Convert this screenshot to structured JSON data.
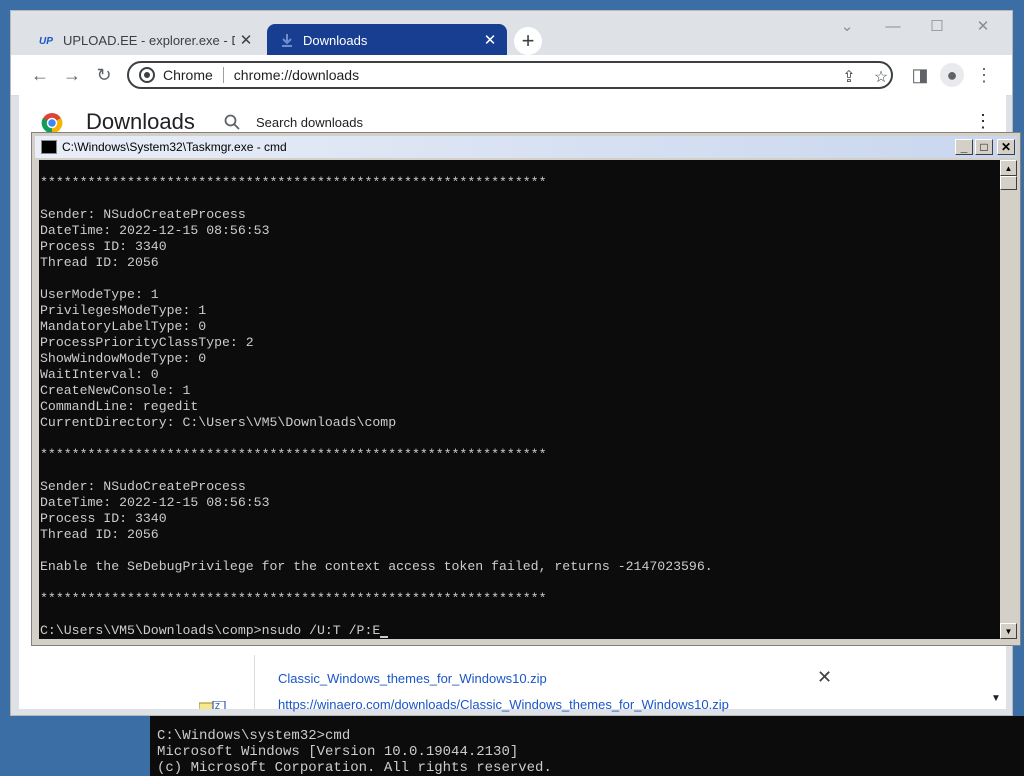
{
  "background_cmd": {
    "lines": [
      "C:\\Windows\\system32>cmd",
      "Microsoft Windows [Version 10.0.19044.2130]",
      "(c) Microsoft Corporation. All rights reserved."
    ]
  },
  "browser": {
    "tabs": [
      {
        "label": "UPLOAD.EE - explorer.exe - Dow",
        "close": "✕"
      },
      {
        "label": "Downloads",
        "close": "✕"
      }
    ],
    "new_tab": "+",
    "window_controls": {
      "min": "⌄",
      "restore": "☐",
      "close": "✕"
    },
    "omnibox": {
      "site_label": "Chrome",
      "url": "chrome://downloads"
    },
    "downloads_page": {
      "title": "Downloads",
      "search_placeholder": "Search downloads",
      "item": {
        "file_name": "Classic_Windows_themes_for_Windows10.zip",
        "url": "https://winaero.com/downloads/Classic_Windows_themes_for_Windows10.zip"
      }
    },
    "accent": "#183e92"
  },
  "console": {
    "title": "C:\\Windows\\System32\\Taskmgr.exe - cmd",
    "lines": [
      "****************************************************************",
      "",
      "Sender: NSudoCreateProcess",
      "DateTime: 2022-12-15 08:56:53",
      "Process ID: 3340",
      "Thread ID: 2056",
      "",
      "UserModeType: 1",
      "PrivilegesModeType: 1",
      "MandatoryLabelType: 0",
      "ProcessPriorityClassType: 2",
      "ShowWindowModeType: 0",
      "WaitInterval: 0",
      "CreateNewConsole: 1",
      "CommandLine: regedit",
      "CurrentDirectory: C:\\Users\\VM5\\Downloads\\comp",
      "",
      "****************************************************************",
      "",
      "Sender: NSudoCreateProcess",
      "DateTime: 2022-12-15 08:56:53",
      "Process ID: 3340",
      "Thread ID: 2056",
      "",
      "Enable the SeDebugPrivilege for the context access token failed, returns -2147023596.",
      "",
      "****************************************************************",
      "",
      "C:\\Users\\VM5\\Downloads\\comp>nsudo /U:T /P:E"
    ]
  }
}
